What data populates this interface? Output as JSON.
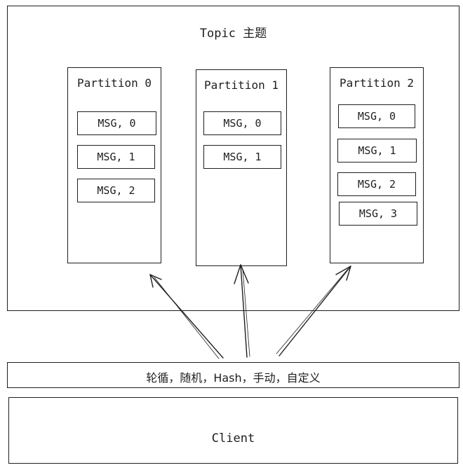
{
  "topic": {
    "title": "Topic 主题"
  },
  "partitions": [
    {
      "title": "Partition 0",
      "messages": [
        "MSG, 0",
        "MSG, 1",
        "MSG, 2"
      ]
    },
    {
      "title": "Partition 1",
      "messages": [
        "MSG, 0",
        "MSG, 1"
      ]
    },
    {
      "title": "Partition 2",
      "messages": [
        "MSG, 0",
        "MSG, 1",
        "MSG, 2",
        "MSG, 3"
      ]
    }
  ],
  "strategy": {
    "label": "轮循，随机，Hash，手动，自定义"
  },
  "client": {
    "label": "Client"
  }
}
